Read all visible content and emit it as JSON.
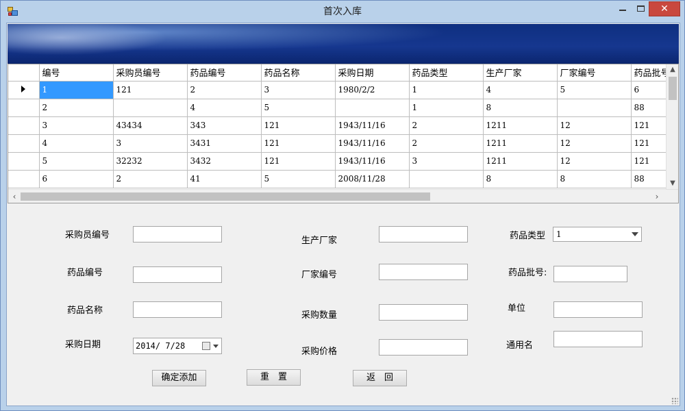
{
  "window": {
    "title": "首次入库",
    "minimize_icon": "minimize-icon",
    "maximize_icon": "maximize-icon",
    "close_label": "✕"
  },
  "grid": {
    "columns": [
      "编号",
      "采购员编号",
      "药品编号",
      "药品名称",
      "采购日期",
      "药品类型",
      "生产厂家",
      "厂家编号",
      "药品批号"
    ],
    "rows": [
      [
        "1",
        "121",
        "2",
        "3",
        "1980/2/2",
        "1",
        "4",
        "5",
        "6"
      ],
      [
        "2",
        "",
        "4",
        "5",
        "",
        "1",
        "8",
        "",
        "88"
      ],
      [
        "3",
        "43434",
        "343",
        "121",
        "1943/11/16",
        "2",
        "1211",
        "12",
        "121"
      ],
      [
        "4",
        "3",
        "3431",
        "121",
        "1943/11/16",
        "2",
        "1211",
        "12",
        "121"
      ],
      [
        "5",
        "32232",
        "3432",
        "121",
        "1943/11/16",
        "3",
        "1211",
        "12",
        "121"
      ],
      [
        "6",
        "2",
        "41",
        "5",
        "2008/11/28",
        "",
        "8",
        "8",
        "88"
      ]
    ],
    "current_row_icon": "row-pointer-icon"
  },
  "form": {
    "buyer_id_label": "采购员编号",
    "buyer_id_value": "",
    "drug_id_label": "药品编号",
    "drug_id_value": "",
    "drug_name_label": "药品名称",
    "drug_name_value": "",
    "purchase_date_label": "采购日期",
    "purchase_date_value": "2014/ 7/28",
    "manufacturer_label": "生产厂家",
    "manufacturer_value": "",
    "vendor_id_label": "厂家编号",
    "vendor_id_value": "",
    "quantity_label": "采购数量",
    "quantity_value": "",
    "price_label": "采购价格",
    "price_value": "",
    "drug_type_label": "药品类型",
    "drug_type_value": "1",
    "batch_label": "药品批号:",
    "batch_value": "",
    "unit_label": "单位",
    "unit_value": "",
    "generic_name_label": "通用名",
    "generic_name_value": ""
  },
  "buttons": {
    "confirm": "确定添加",
    "reset": "重　置",
    "back": "返　回"
  }
}
